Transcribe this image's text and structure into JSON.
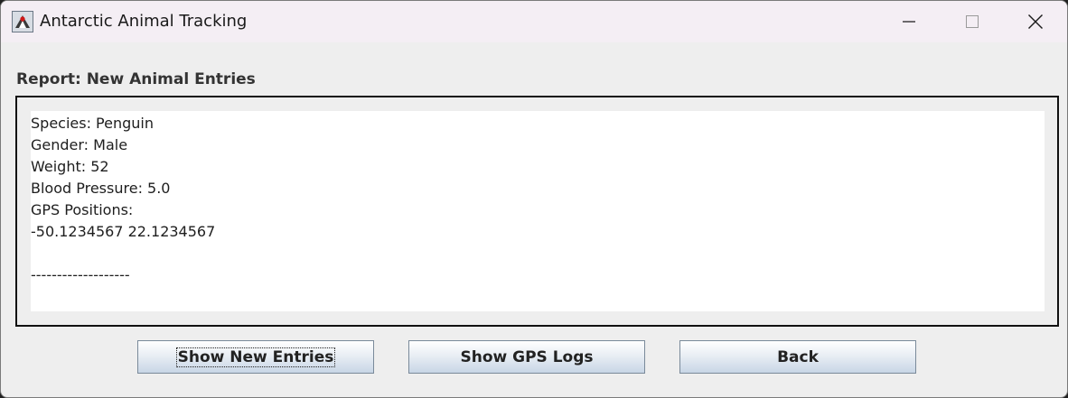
{
  "window": {
    "title": "Antarctic Animal Tracking",
    "controls": [
      "minimize",
      "maximize",
      "close"
    ]
  },
  "report": {
    "heading": "Report: New Animal Entries",
    "lines": [
      "Species: Penguin",
      "Gender: Male",
      "Weight: 52",
      "Blood Pressure: 5.0",
      "GPS Positions:",
      "-50.1234567 22.1234567",
      "",
      "-------------------"
    ]
  },
  "buttons": {
    "show_new_entries": "Show New Entries",
    "show_gps_logs": "Show GPS Logs",
    "back": "Back"
  },
  "icons": {
    "app": "java-duke-icon",
    "minimize": "minimize-icon",
    "maximize": "maximize-icon",
    "close": "close-icon"
  }
}
